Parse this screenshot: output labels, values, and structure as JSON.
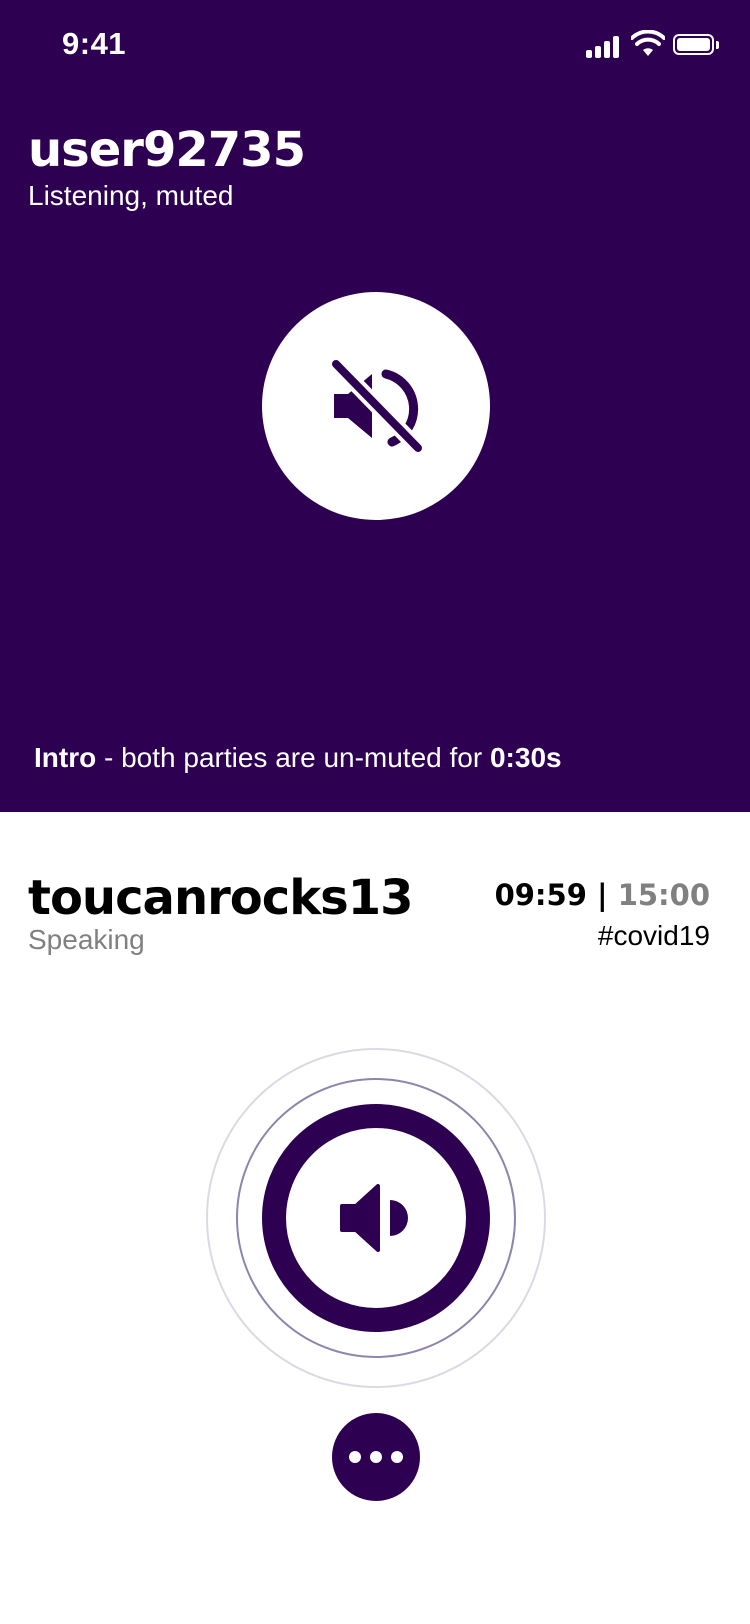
{
  "status_bar": {
    "time": "9:41",
    "icons": [
      "cellular-signal-icon",
      "wifi-icon",
      "battery-icon"
    ]
  },
  "self": {
    "username": "user92735",
    "status": "Listening, muted",
    "button_icon": "speaker-muted-icon"
  },
  "intro_banner": {
    "label": "Intro",
    "text": " - both parties are un-muted for ",
    "duration": "0:30s"
  },
  "peer": {
    "username": "toucanrocks13",
    "status": "Speaking",
    "timer_elapsed": "09:59",
    "timer_separator": " | ",
    "timer_total": "15:00",
    "topic": "#covid19",
    "button_icon": "speaker-icon"
  },
  "more_button": {
    "icon": "more-dots-icon"
  },
  "colors": {
    "brand_purple": "#2e0052",
    "white": "#ffffff",
    "muted_text": "#808080"
  }
}
